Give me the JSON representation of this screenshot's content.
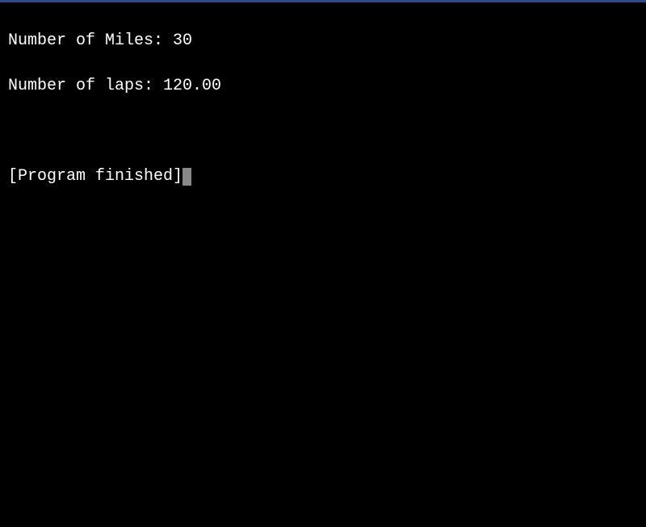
{
  "terminal": {
    "lines": {
      "miles_label": "Number of Miles: ",
      "miles_value": "30",
      "laps_label": "Number of laps: ",
      "laps_value": "120.00",
      "blank": "",
      "blank2": "",
      "status": "[Program finished]"
    }
  }
}
